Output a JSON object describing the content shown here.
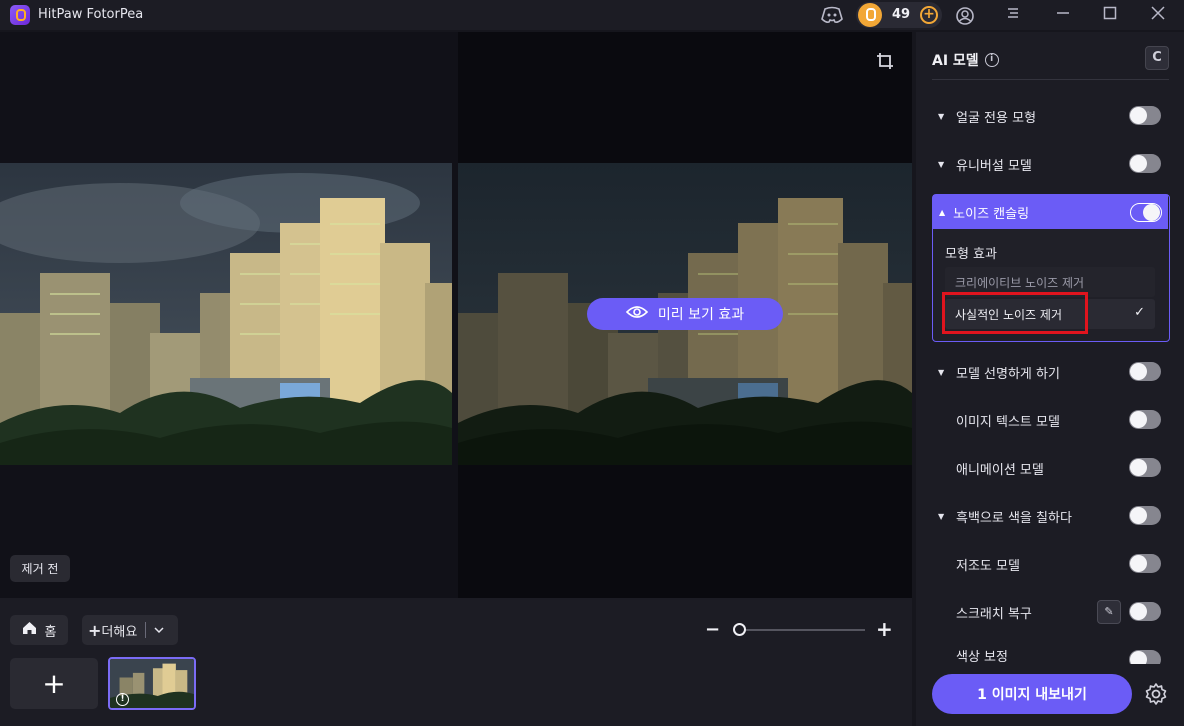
{
  "titlebar": {
    "app_title": "HitPaw FotorPea",
    "coins": "49"
  },
  "canvas": {
    "preview_label": "미리 보기 효과",
    "before_label": "제거 전"
  },
  "bottombar": {
    "home_label": "홈",
    "add_label": "더해요"
  },
  "panel": {
    "title": "AI 모델",
    "rows": [
      {
        "label": "얼굴 전용 모형",
        "on": false
      },
      {
        "label": "유니버설 모델",
        "on": false
      },
      {
        "label": "노이즈 캔슬링",
        "on": true
      },
      {
        "label": "모델 선명하게 하기",
        "on": false
      },
      {
        "label": "이미지 텍스트 모델",
        "on": false
      },
      {
        "label": "애니메이션 모델",
        "on": false
      },
      {
        "label": "흑백으로 색을 칠하다",
        "on": false
      },
      {
        "label": "저조도 모델",
        "on": false
      },
      {
        "label": "스크래치 복구",
        "on": false
      },
      {
        "label": "색상 보정",
        "on": false
      }
    ],
    "noise": {
      "effect_label": "모형 효과",
      "options": [
        "크리에이티브 노이즈 제거",
        "사실적인 노이즈 제거"
      ],
      "selected": "사실적인 노이즈 제거"
    },
    "export_label": "1 이미지 내보내기"
  },
  "colors": {
    "accent": "#6b5cf6",
    "highlight": "#e0141e",
    "coin": "#f2a736"
  }
}
